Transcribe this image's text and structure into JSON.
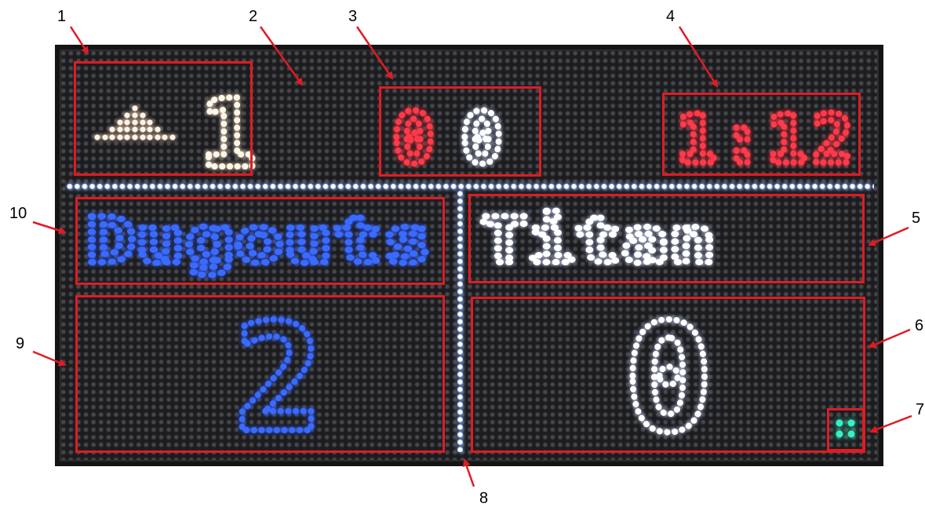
{
  "scoreboard": {
    "inning_indicator": {
      "icon": "triangle-up-icon",
      "value": "1"
    },
    "count": {
      "balls": "0",
      "strikes": "0"
    },
    "clock": {
      "value": "1:12"
    },
    "teams": {
      "home": {
        "name": "Dugouts",
        "score": "2",
        "color": "#3a6bff"
      },
      "away": {
        "name": "Titan",
        "score": "0",
        "color": "#ffffff"
      }
    },
    "status_led": {
      "icon": "status-dot-icon",
      "color": "#39f0c4"
    }
  },
  "callouts": [
    "1",
    "2",
    "3",
    "4",
    "5",
    "6",
    "7",
    "8",
    "9",
    "10"
  ],
  "colors": {
    "region_outline": "#e01b24",
    "panel": "#1c1c1e",
    "divider": "#ffffff",
    "clock": "#ff3a4a",
    "count_active": "#ff3a4a"
  }
}
